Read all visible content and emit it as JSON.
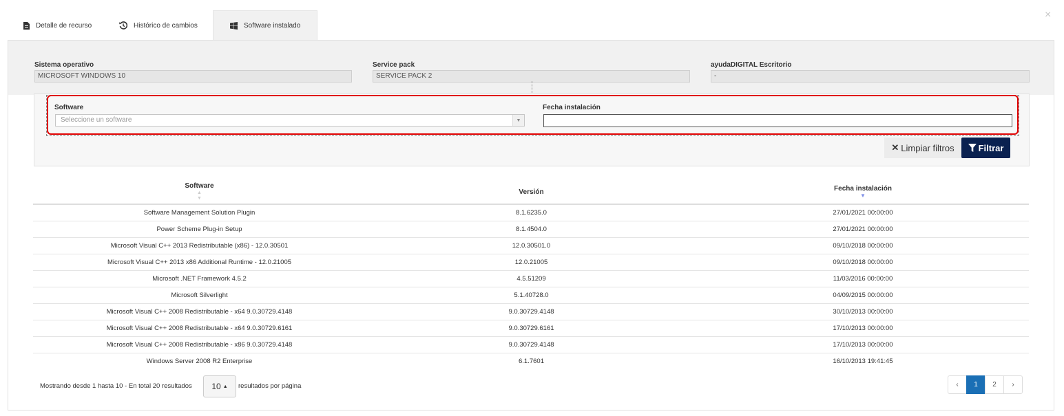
{
  "close_label": "×",
  "tabs": [
    {
      "label": "Detalle de recurso",
      "icon": "document-icon"
    },
    {
      "label": "Histórico de cambios",
      "icon": "history-icon"
    },
    {
      "label": "Software instalado",
      "icon": "windows-icon",
      "active": true
    }
  ],
  "info": {
    "os": {
      "label": "Sistema operativo",
      "value": "MICROSOFT WINDOWS 10"
    },
    "service_pack": {
      "label": "Service pack",
      "value": "SERVICE PACK 2"
    },
    "ayuda": {
      "label": "ayudaDIGITAL Escritorio",
      "value": "-"
    }
  },
  "filters": {
    "software_label": "Software",
    "software_placeholder": "Seleccione un software",
    "date_label": "Fecha instalación",
    "date_value": "",
    "clear_label": "Limpiar filtros",
    "filter_label": "Filtrar"
  },
  "table": {
    "headers": [
      "Software",
      "Versión",
      "Fecha instalación"
    ],
    "rows": [
      [
        "Software Management Solution Plugin",
        "8.1.6235.0",
        "27/01/2021 00:00:00"
      ],
      [
        "Power Scheme Plug-in Setup",
        "8.1.4504.0",
        "27/01/2021 00:00:00"
      ],
      [
        "Microsoft Visual C++ 2013 Redistributable (x86) - 12.0.30501",
        "12.0.30501.0",
        "09/10/2018 00:00:00"
      ],
      [
        "Microsoft Visual C++ 2013 x86 Additional Runtime - 12.0.21005",
        "12.0.21005",
        "09/10/2018 00:00:00"
      ],
      [
        "Microsoft .NET Framework 4.5.2",
        "4.5.51209",
        "11/03/2016 00:00:00"
      ],
      [
        "Microsoft Silverlight",
        "5.1.40728.0",
        "04/09/2015 00:00:00"
      ],
      [
        "Microsoft Visual C++ 2008 Redistributable - x64 9.0.30729.4148",
        "9.0.30729.4148",
        "30/10/2013 00:00:00"
      ],
      [
        "Microsoft Visual C++ 2008 Redistributable - x64 9.0.30729.6161",
        "9.0.30729.6161",
        "17/10/2013 00:00:00"
      ],
      [
        "Microsoft Visual C++ 2008 Redistributable - x86 9.0.30729.4148",
        "9.0.30729.4148",
        "17/10/2013 00:00:00"
      ],
      [
        "Windows Server 2008 R2 Enterprise",
        "6.1.7601",
        "16/10/2013 19:41:45"
      ]
    ]
  },
  "footer": {
    "showing_text": "Mostrando desde 1 hasta 10 - En total 20 resultados",
    "page_size": "10",
    "per_page_text": "resultados por página"
  },
  "pagination": {
    "prev": "‹",
    "pages": [
      "1",
      "2"
    ],
    "active_page": "1",
    "next": "›"
  },
  "colors": {
    "accent": "#0a2150",
    "highlight": "#e00000",
    "active_page": "#1a6fb5"
  }
}
